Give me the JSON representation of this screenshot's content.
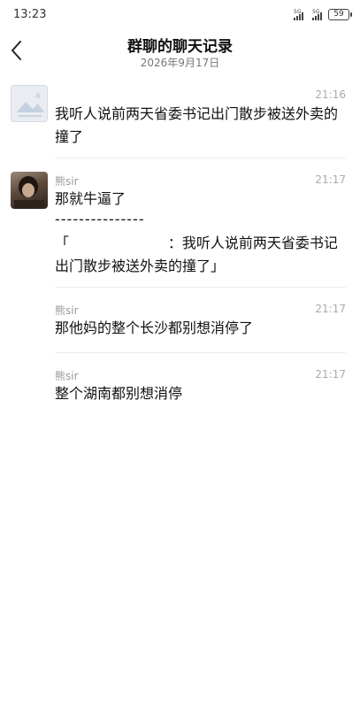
{
  "status_bar": {
    "time": "13:23",
    "signal1_label": "5G",
    "signal2_label": "5G",
    "battery": "59"
  },
  "header": {
    "title": "群聊的聊天记录",
    "subtitle": "2026年9月17日"
  },
  "messages": [
    {
      "time": "21:16",
      "text": "我听人说前两天省委书记出门散步被送外卖的撞了"
    },
    {
      "sender": "熊sir",
      "time": "21:17",
      "text": "那就牛逼了",
      "separator": "---------------",
      "quote": "「                      ：我听人说前两天省委书记出门散步被送外卖的撞了」"
    },
    {
      "sender": "熊sir",
      "time": "21:17",
      "text": "那他妈的整个长沙都别想消停了"
    },
    {
      "sender": "熊sir",
      "time": "21:17",
      "text": "整个湖南都别想消停"
    }
  ]
}
